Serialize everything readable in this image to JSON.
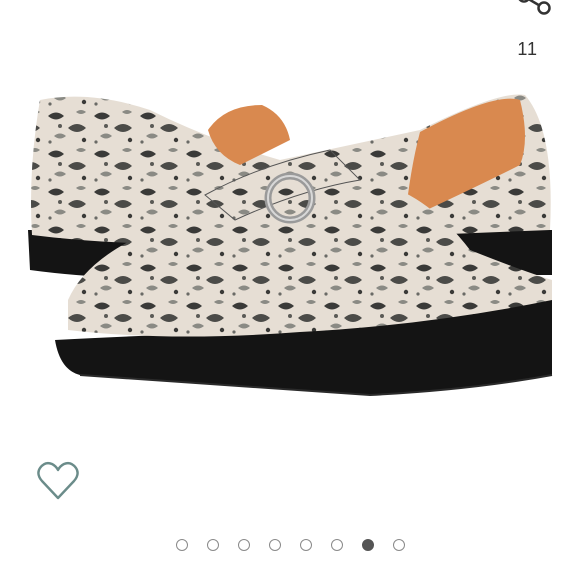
{
  "share": {
    "icon": "share-icon",
    "count": "11"
  },
  "product": {
    "image_icon": "loafer-shoe-image",
    "colors": {
      "sole": "#141414",
      "lining": "#d9894f",
      "hardware": "#9a9a9a",
      "skin_light": "#e6ded4",
      "skin_dark": "#3a3a38"
    }
  },
  "favorite": {
    "icon": "heart-outline-icon",
    "color": "#6b8c8a"
  },
  "carousel": {
    "total": 8,
    "active_index": 6,
    "active_color": "#555555"
  }
}
